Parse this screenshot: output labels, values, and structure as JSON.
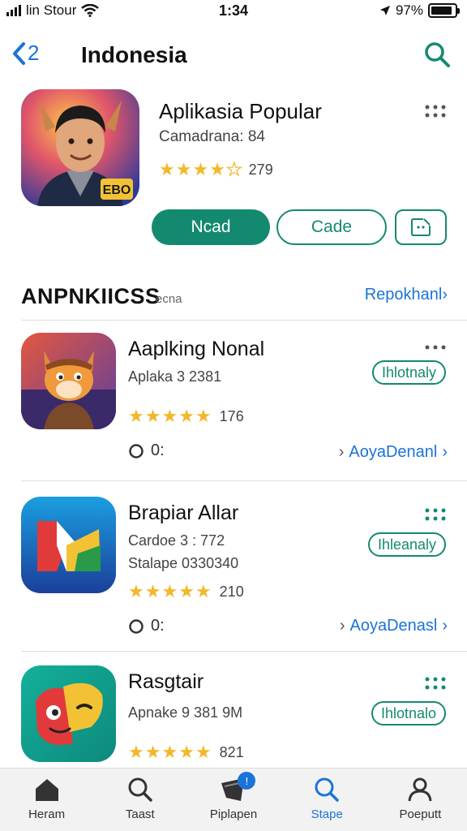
{
  "status": {
    "carrier": "lin Stour",
    "time": "1:34",
    "battery": "97%"
  },
  "nav": {
    "back_label": "2",
    "title": "Indonesia"
  },
  "hero": {
    "title": "Aplikasia Popular",
    "subtitle": "Camadrana: 84",
    "rating": 3.5,
    "rating_count": "279",
    "primary_button": "Ncad",
    "secondary_button": "Cade",
    "icon_label": "EBO"
  },
  "section": {
    "title": "ANPNKIICSS",
    "note": "ecna",
    "link": "Repokhanl"
  },
  "apps": [
    {
      "name": "Aaplking Nonal",
      "line1": "Aplaka 3 2381",
      "line2": "",
      "rating": 4.5,
      "rating_count": "176",
      "badge": "Ihlotnaly",
      "meta": "0:",
      "link": "AoyaDenanl",
      "colors": [
        "#e4573f",
        "#5b3ea0"
      ]
    },
    {
      "name": "Brapiar Allar",
      "line1": "Cardoe 3 : 772",
      "line2": "Stalape 0330340",
      "rating": 4.5,
      "rating_count": "210",
      "badge": "Ihleanaly",
      "meta": "0:",
      "link": "AoyaDenasl",
      "colors": [
        "#1b9ee0",
        "#1b3f9a"
      ]
    },
    {
      "name": "Rasgtair",
      "line1": "Apnake 9 381 9M",
      "line2": "",
      "rating": 4.5,
      "rating_count": "821",
      "badge": "Ihlotnalo",
      "meta": "",
      "link": "",
      "colors": [
        "#13b09a",
        "#0d8a7d"
      ]
    }
  ],
  "tabs": [
    {
      "label": "Heram",
      "icon": "home-icon"
    },
    {
      "label": "Taast",
      "icon": "search-icon"
    },
    {
      "label": "Piplapen",
      "icon": "apps-icon",
      "badge": "!"
    },
    {
      "label": "Stape",
      "icon": "search-icon",
      "active": true
    },
    {
      "label": "Poeputt",
      "icon": "person-icon"
    }
  ],
  "colors": {
    "accent_green": "#138a70",
    "accent_blue": "#1a73d9",
    "star": "#f3b72a"
  }
}
